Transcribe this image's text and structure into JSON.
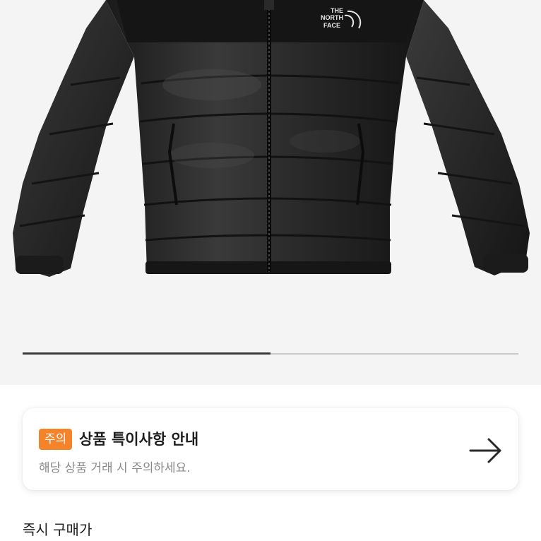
{
  "product": {
    "image_alt": "black puffer jacket",
    "brand_logo": [
      "THE",
      "NORTH",
      "FACE"
    ],
    "gallery_progress": 0.5
  },
  "notice": {
    "badge": "주의",
    "title": "상품 특이사항 안내",
    "description": "해당 상품 거래 시 주의하세요.",
    "arrow_icon": "arrow-right-icon"
  },
  "buy_section": {
    "label": "즉시 구매가"
  },
  "colors": {
    "accent": "#f5832a",
    "background": "#f4f4f4",
    "progress_fill": "#3c3c3c",
    "progress_track": "#c8c8c8"
  }
}
